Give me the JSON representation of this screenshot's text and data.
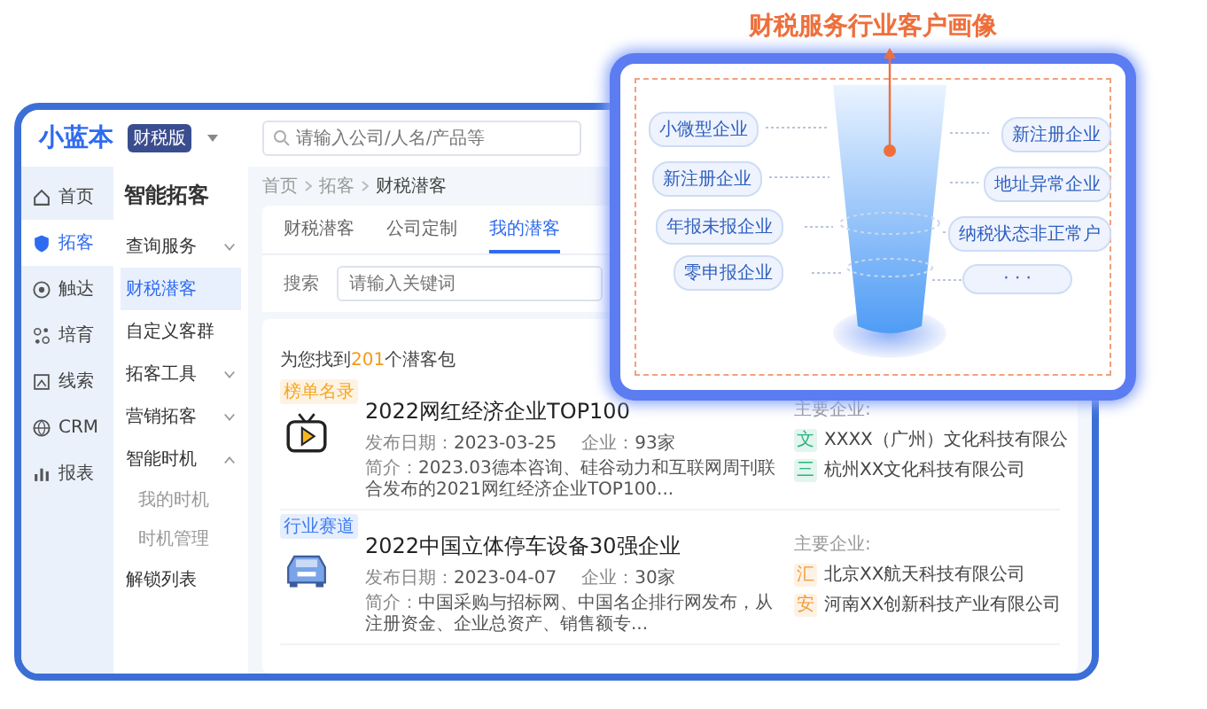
{
  "app": {
    "logo": "小蓝本",
    "edition_badge": "财税版",
    "search": {
      "placeholder": "请输入公司/人名/产品等"
    }
  },
  "nav": [
    {
      "label": "首页",
      "selected": false
    },
    {
      "label": "拓客",
      "selected": true
    },
    {
      "label": "触达",
      "selected": false
    },
    {
      "label": "培育",
      "selected": false
    },
    {
      "label": "线索",
      "selected": false
    },
    {
      "label": "CRM",
      "selected": false
    },
    {
      "label": "报表",
      "selected": false
    }
  ],
  "menu": {
    "title": "智能拓客",
    "items": [
      {
        "kind": "group",
        "label": "查询服务",
        "expanded": false
      },
      {
        "kind": "link",
        "label": "财税潜客",
        "selected": true
      },
      {
        "kind": "link",
        "label": "自定义客群",
        "selected": false
      },
      {
        "kind": "group",
        "label": "拓客工具",
        "expanded": false
      },
      {
        "kind": "group",
        "label": "营销拓客",
        "expanded": false
      },
      {
        "kind": "group",
        "label": "智能时机",
        "expanded": true,
        "children": [
          {
            "label": "我的时机",
            "selected": false
          },
          {
            "label": "时机管理",
            "selected": false
          }
        ]
      },
      {
        "kind": "link",
        "label": "解锁列表",
        "selected": false
      }
    ]
  },
  "breadcrumb": [
    "首页",
    "拓客",
    "财税潜客"
  ],
  "tabs": [
    {
      "label": "财税潜客",
      "selected": false
    },
    {
      "label": "公司定制",
      "selected": false
    },
    {
      "label": "我的潜客",
      "selected": true
    }
  ],
  "filter": {
    "label": "搜索",
    "placeholder": "请输入关键词"
  },
  "result_summary": {
    "prefix": "为您找到",
    "count": "201",
    "suffix": "个潜客包"
  },
  "packages": [
    {
      "tag": "榜单名录",
      "color": "#f6a623",
      "title": "2022网红经济企业TOP100",
      "date_label": "发布日期：",
      "date": "2023-03-25",
      "count_label": "企业：",
      "count": "93家",
      "intro_label": "简介：",
      "intro": "2023.03德本咨询、硅谷动力和互联网周刊联合发布的2021网红经济企业TOP100...",
      "companies_label": "主要企业:",
      "companies": [
        {
          "mark": "文",
          "name": "XXXX（广州）文化科技有限公",
          "color": "#2bb57e"
        },
        {
          "mark": "三",
          "name": "杭州XX文化科技有限公司",
          "color": "#2bb57e"
        }
      ]
    },
    {
      "tag": "行业赛道",
      "color": "#3d7cf2",
      "title": "2022中国立体停车设备30强企业",
      "date_label": "发布日期：",
      "date": "2023-04-07",
      "count_label": "企业：",
      "count": "30家",
      "intro_label": "简介：",
      "intro": "中国采购与招标网、中国名企排行网发布，从注册资金、企业总资产、销售额专...",
      "companies_label": "主要企业:",
      "companies": [
        {
          "mark": "汇",
          "name": "北京XX航天科技有限公司",
          "color": "#f29a3a"
        },
        {
          "mark": "安",
          "name": "河南XX创新科技产业有限公司",
          "color": "#f29a3a"
        }
      ]
    }
  ],
  "portrait": {
    "title": "财税服务行业客户画像",
    "left_tags": [
      "小微型企业",
      "新注册企业",
      "年报未报企业",
      "零申报企业"
    ],
    "right_tags": [
      "新注册企业",
      "地址异常企业",
      "纳税状态非正常户",
      "· · ·"
    ]
  }
}
